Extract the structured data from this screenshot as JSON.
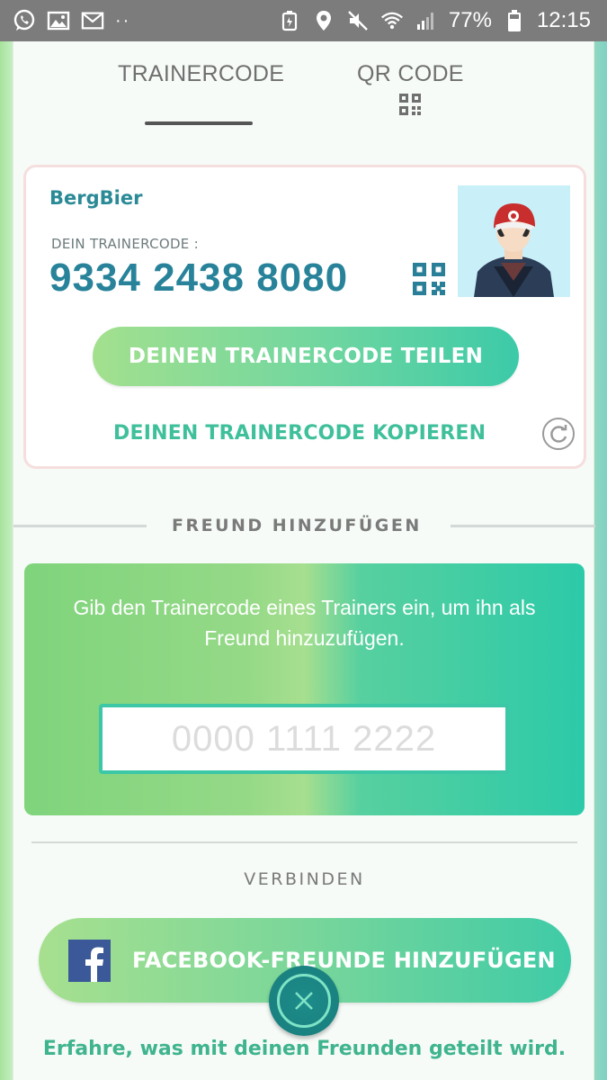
{
  "status_bar": {
    "left_icons": [
      "whatsapp-icon",
      "gallery-icon",
      "mail-icon"
    ],
    "dots": "··",
    "right_icons": [
      "battery-saver-icon",
      "location-icon",
      "mute-icon",
      "wifi-icon",
      "signal-icon"
    ],
    "battery_percent": "77%",
    "time": "12:15"
  },
  "tabs": {
    "trainer_code": "TRAINERCODE",
    "qr_code": "QR CODE",
    "active": "trainer_code"
  },
  "trainer_card": {
    "name": "BergBier",
    "code_label": "DEIN TRAINERCODE :",
    "code": "9334 2438 8080",
    "share_button": "DEINEN TRAINERCODE TEILEN",
    "copy_link": "DEINEN TRAINERCODE KOPIEREN"
  },
  "add_friend": {
    "section_title": "FREUND HINZUFÜGEN",
    "instructions": "Gib den Trainercode eines Trainers ein, um ihn als Freund hinzuzufügen.",
    "input_placeholder": "0000 1111 2222",
    "input_value": ""
  },
  "connect": {
    "section_title": "VERBINDEN",
    "facebook_button": "FACEBOOK-FREUNDE HINZUFÜGEN",
    "info_link": "Erfahre, was mit deinen Freunden geteilt wird."
  },
  "colors": {
    "status_bar": "#7c7c7c",
    "code_text": "#28839a",
    "link_green": "#3fc09b",
    "facebook_blue": "#3b5998",
    "close_teal": "#1d8c8a"
  }
}
